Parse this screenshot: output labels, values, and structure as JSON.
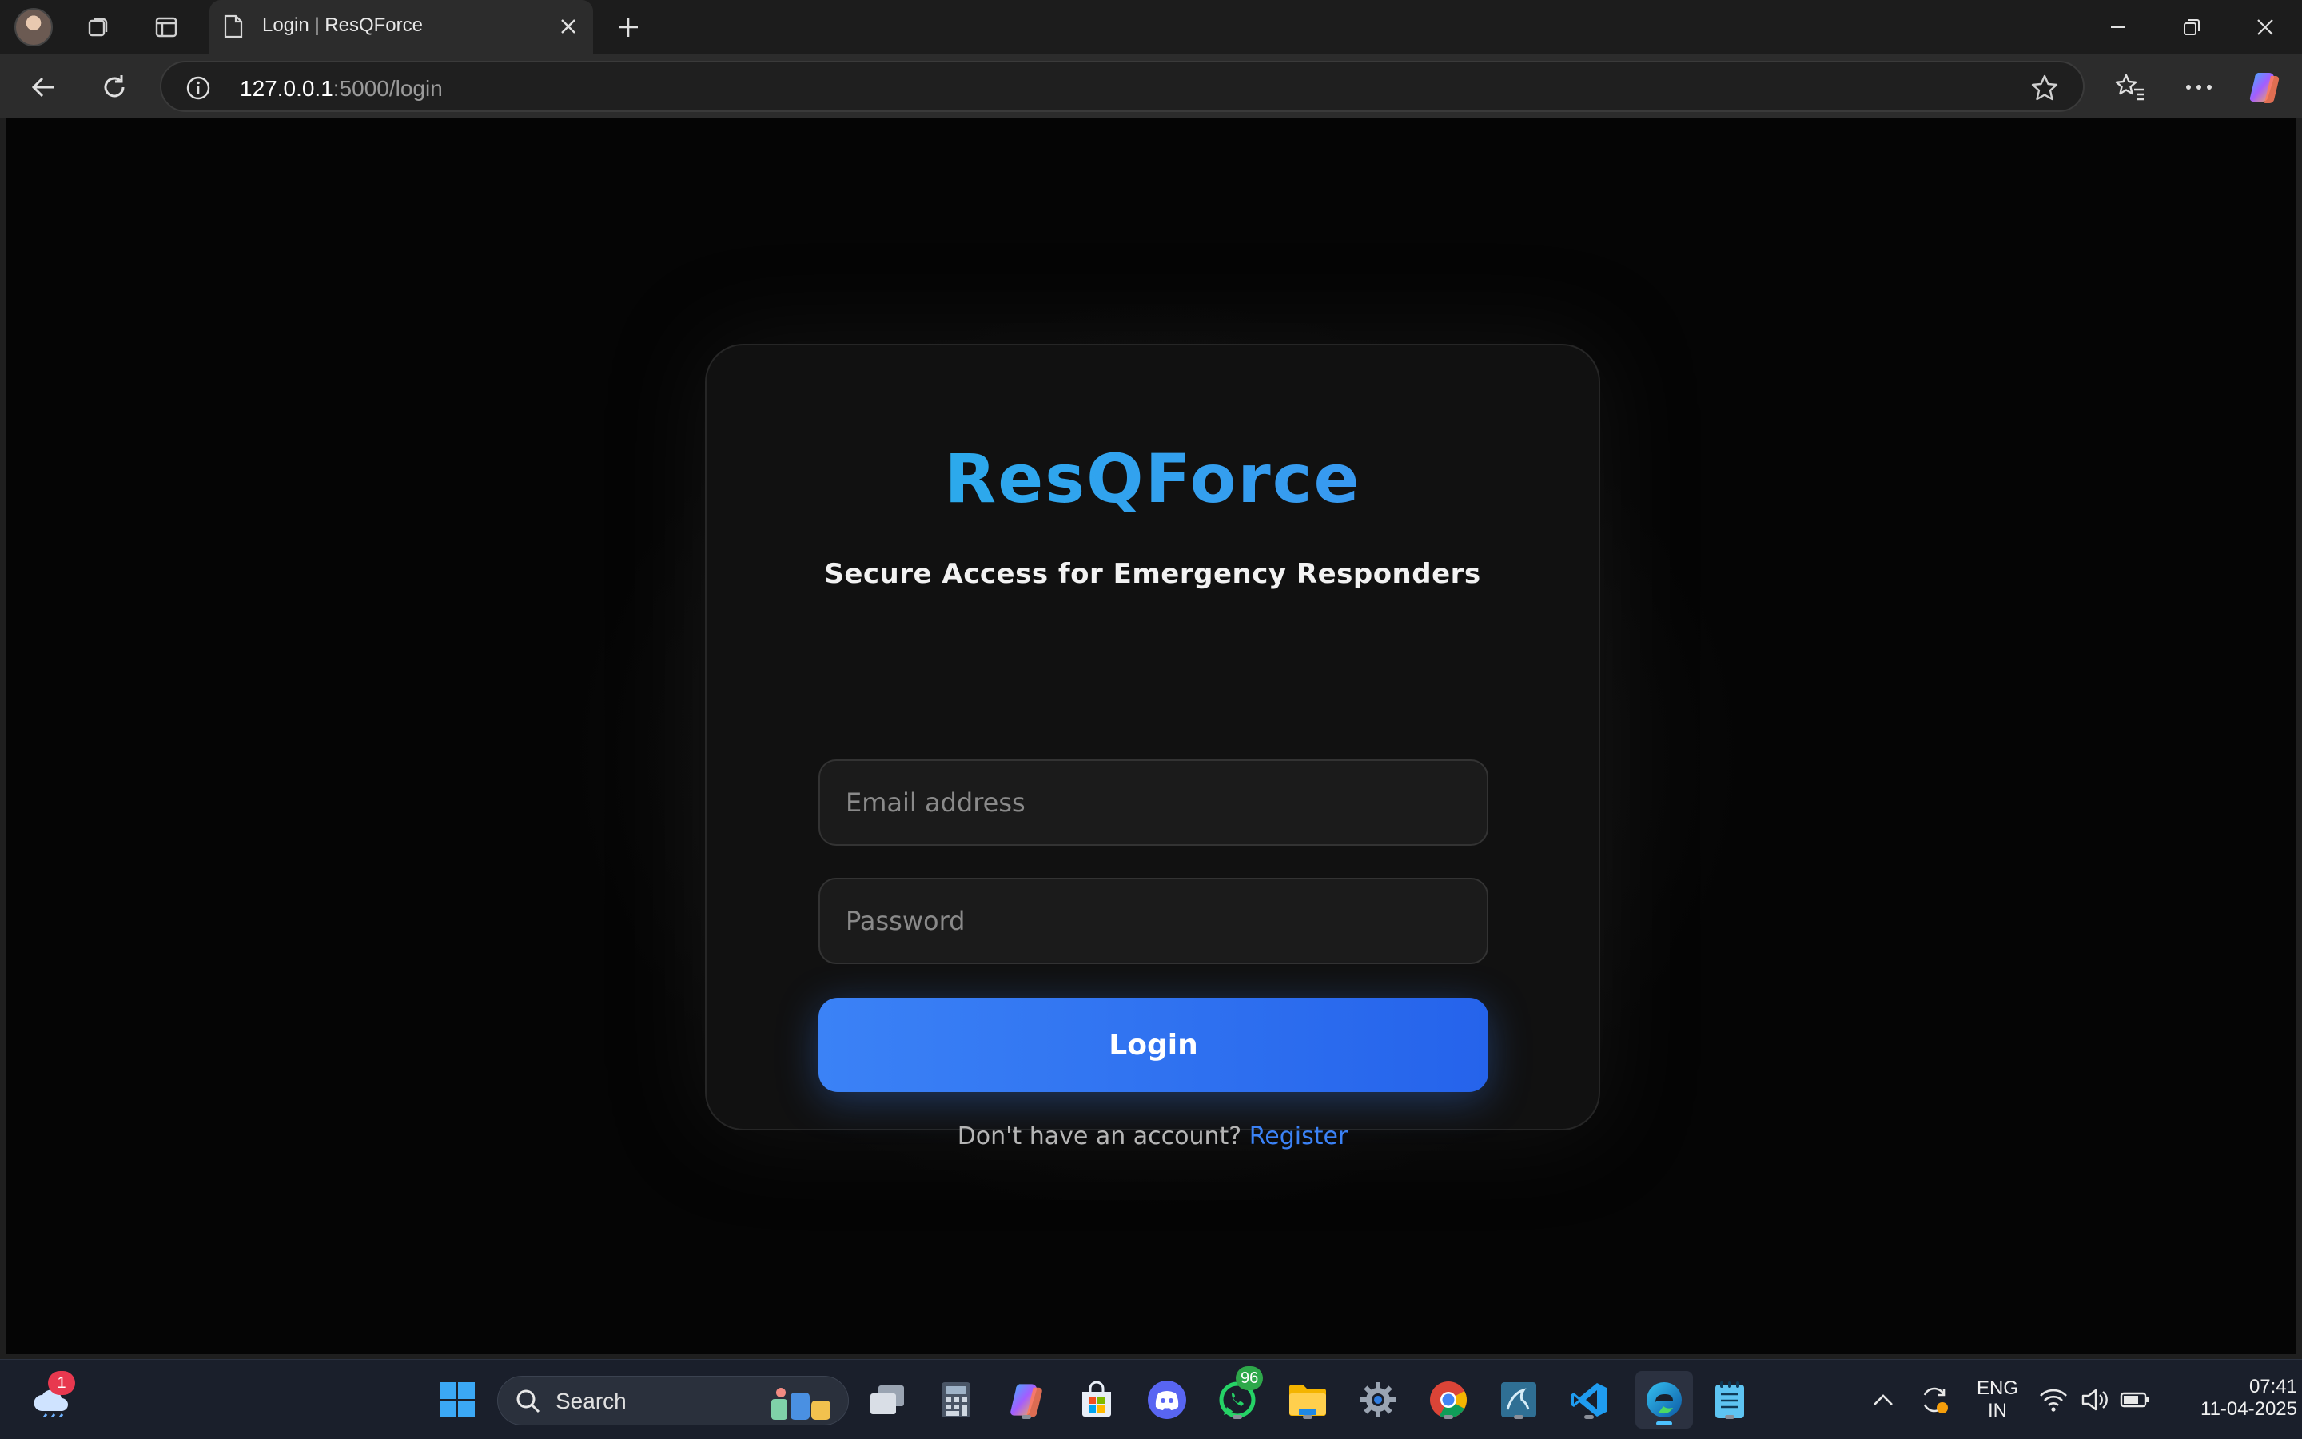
{
  "browser": {
    "tab_title": "Login | ResQForce",
    "url_host": "127.0.0.1",
    "url_path": ":5000/login"
  },
  "page": {
    "brand": "ResQForce",
    "subtitle": "Secure Access for Emergency Responders",
    "email_placeholder": "Email address",
    "password_placeholder": "Password",
    "login_label": "Login",
    "no_account_text": "Don't have an account?",
    "register_label": "Register"
  },
  "taskbar": {
    "search_label": "Search",
    "weather_badge": "1",
    "whatsapp_badge": "96",
    "language_top": "ENG",
    "language_bottom": "IN",
    "time": "07:41",
    "date": "11-04-2025"
  },
  "colors": {
    "accent": "#3b82f6",
    "brand_gradient_start": "#25b3ea",
    "brand_gradient_end": "#3f8ff2",
    "background": "#050505"
  }
}
